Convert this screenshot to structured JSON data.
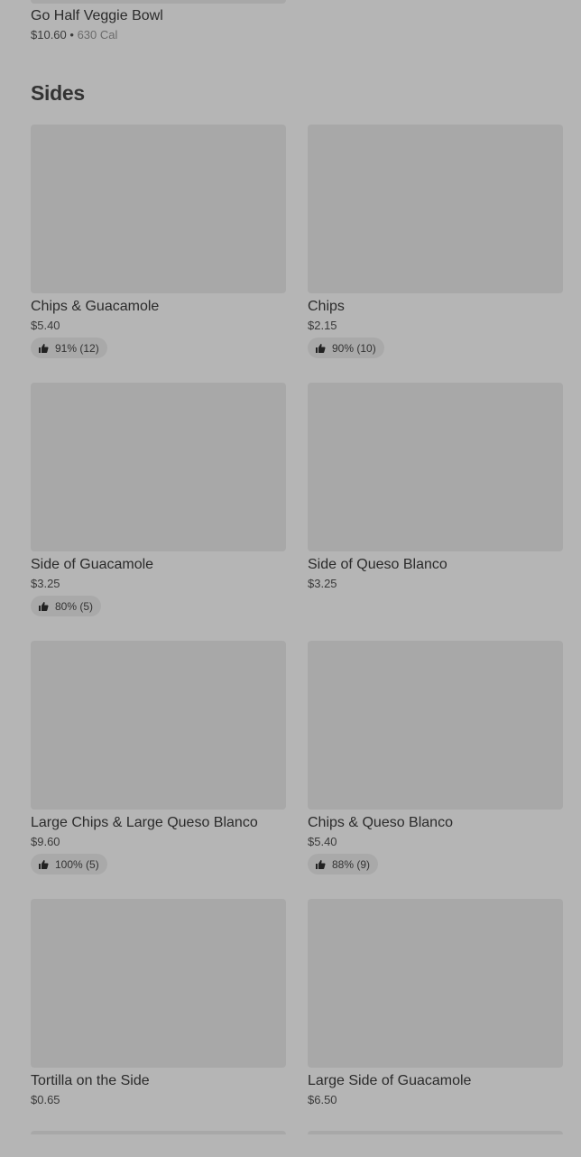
{
  "previous_item": {
    "name": "Go Half Veggie Bowl",
    "price": "$10.60",
    "separator": "•",
    "calories": "630 Cal"
  },
  "section": {
    "title": "Sides"
  },
  "items": [
    {
      "name": "Chips & Guacamole",
      "price": "$5.40",
      "rating": "91% (12)"
    },
    {
      "name": "Chips",
      "price": "$2.15",
      "rating": "90% (10)"
    },
    {
      "name": "Side of Guacamole",
      "price": "$3.25",
      "rating": "80% (5)"
    },
    {
      "name": "Side of Queso Blanco",
      "price": "$3.25",
      "rating": null
    },
    {
      "name": "Large Chips & Large Queso Blanco",
      "price": "$9.60",
      "rating": "100% (5)"
    },
    {
      "name": "Chips & Queso Blanco",
      "price": "$5.40",
      "rating": "88% (9)"
    },
    {
      "name": "Tortilla on the Side",
      "price": "$0.65",
      "rating": null
    },
    {
      "name": "Large Side of Guacamole",
      "price": "$6.50",
      "rating": null
    }
  ],
  "icons": {
    "rating": "thumbs-up-icon"
  },
  "colors": {
    "background": "#b5b5b5",
    "image_placeholder": "#a8a8a8",
    "badge": "#a9a9a9"
  }
}
